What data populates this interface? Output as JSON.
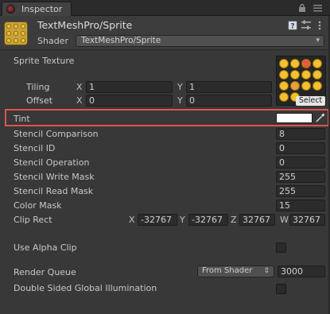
{
  "window": {
    "tab_title": "Inspector"
  },
  "header": {
    "material_name": "TextMeshPro/Sprite",
    "shader_label": "Shader",
    "shader_value": "TextMeshPro/Sprite"
  },
  "sprite_texture": {
    "label": "Sprite Texture",
    "tiling_label": "Tiling",
    "tiling_x": "1",
    "tiling_y": "1",
    "offset_label": "Offset",
    "offset_x": "0",
    "offset_y": "0",
    "axis_x": "X",
    "axis_y": "Y",
    "select_label": "Select"
  },
  "tint": {
    "label": "Tint",
    "color": "#ffffff"
  },
  "properties": [
    {
      "label": "Stencil Comparison",
      "value": "8"
    },
    {
      "label": "Stencil ID",
      "value": "0"
    },
    {
      "label": "Stencil Operation",
      "value": "0"
    },
    {
      "label": "Stencil Write Mask",
      "value": "255"
    },
    {
      "label": "Stencil Read Mask",
      "value": "255"
    },
    {
      "label": "Color Mask",
      "value": "15"
    }
  ],
  "clip_rect": {
    "label": "Clip Rect",
    "x_label": "X",
    "x": "-32767",
    "y_label": "Y",
    "y": "-32767",
    "z_label": "Z",
    "z": "32767",
    "w_label": "W",
    "w": "32767"
  },
  "alpha_clip": {
    "label": "Use Alpha Clip",
    "checked": false
  },
  "render_queue": {
    "label": "Render Queue",
    "mode": "From Shader",
    "value": "3000"
  },
  "double_sided": {
    "label": "Double Sided Global Illumination",
    "checked": false
  },
  "colors": {
    "highlight": "#e0534d",
    "background": "#383838"
  }
}
